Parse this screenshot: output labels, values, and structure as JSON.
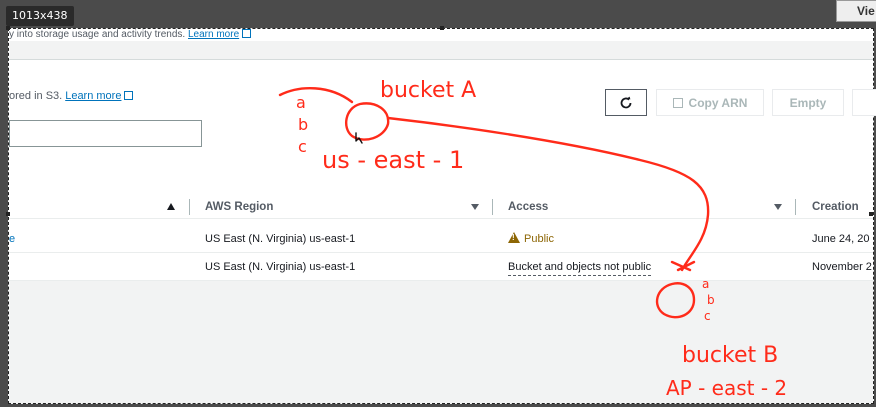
{
  "recorder": {
    "dimensions_badge": "1013x438",
    "view_button": "Vie"
  },
  "page": {
    "top_strip_text": "y into storage usage and activity trends.",
    "top_strip_link": "Learn more",
    "subtitle_text": "ored in S3.",
    "subtitle_link": "Learn more",
    "search_value": ""
  },
  "toolbar": {
    "refresh_icon": "refresh-icon",
    "copy_arn_label": "Copy ARN",
    "empty_label": "Empty"
  },
  "table": {
    "columns": [
      "AWS Region",
      "Access",
      "Creation da"
    ],
    "rows": [
      {
        "region": "US East (N. Virginia) us-east-1",
        "access": "Public",
        "created": "June 24, 20"
      },
      {
        "region": "US East (N. Virginia) us-east-1",
        "access": "Bucket and objects not public",
        "created": "November 2"
      }
    ],
    "left_edge_marker": "e"
  },
  "annotations": {
    "color": "#ff2b1a",
    "bucket_a_label": "bucket A",
    "bucket_a_letters": [
      "a",
      "b",
      "c"
    ],
    "bucket_a_region": "us - east - 1",
    "bucket_b_label": "bucket B",
    "bucket_b_letters": [
      "a",
      "b",
      "c"
    ],
    "bucket_b_region": "AP - east - 2"
  }
}
